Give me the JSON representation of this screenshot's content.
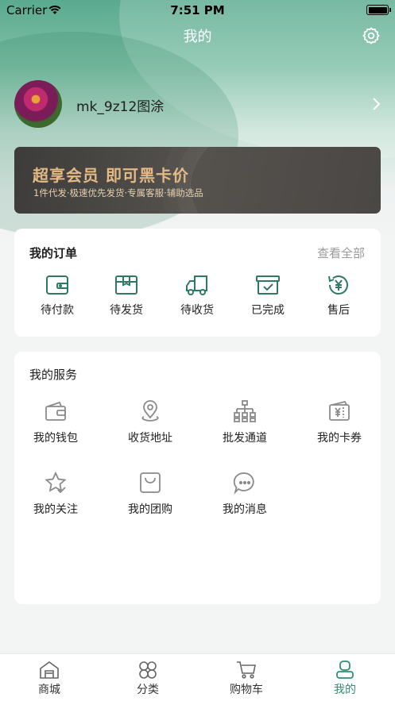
{
  "status_bar": {
    "carrier": "Carrier",
    "time": "7:51 PM"
  },
  "nav": {
    "title": "我的"
  },
  "profile": {
    "username": "mk_9z12图涂"
  },
  "vip_banner": {
    "title": "超享会员 即可黑卡价",
    "subtitle": "1件代发·极速优先发货·专属客服·辅助选品"
  },
  "orders": {
    "title": "我的订单",
    "view_all": "查看全部",
    "items": [
      {
        "label": "待付款",
        "icon": "wallet-card-icon"
      },
      {
        "label": "待发货",
        "icon": "package-box-icon"
      },
      {
        "label": "待收货",
        "icon": "delivery-truck-icon"
      },
      {
        "label": "已完成",
        "icon": "archive-check-icon"
      },
      {
        "label": "售后",
        "icon": "yuan-refund-icon"
      }
    ]
  },
  "services": {
    "title": "我的服务",
    "items": [
      {
        "label": "我的钱包",
        "icon": "wallet-icon"
      },
      {
        "label": "收货地址",
        "icon": "location-pin-icon"
      },
      {
        "label": "批发通道",
        "icon": "org-chart-icon"
      },
      {
        "label": "我的卡券",
        "icon": "coupon-icon"
      },
      {
        "label": "我的关注",
        "icon": "star-check-icon"
      },
      {
        "label": "我的团购",
        "icon": "shopping-bag-icon"
      },
      {
        "label": "我的消息",
        "icon": "chat-bubble-icon"
      }
    ]
  },
  "tabbar": {
    "items": [
      {
        "label": "商城",
        "icon": "store-icon"
      },
      {
        "label": "分类",
        "icon": "category-grid-icon"
      },
      {
        "label": "购物车",
        "icon": "cart-icon"
      },
      {
        "label": "我的",
        "icon": "profile-icon",
        "active": true
      }
    ]
  },
  "colors": {
    "accent": "#2f8f6f",
    "vip_gold": "#e3b985",
    "icon_green": "#2e7a60"
  }
}
